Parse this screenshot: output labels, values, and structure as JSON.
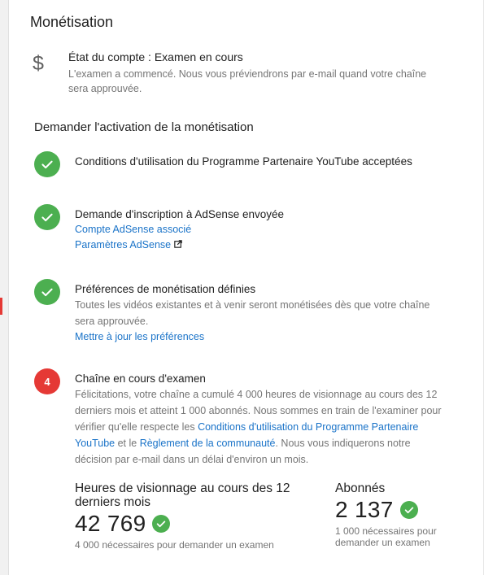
{
  "page": {
    "title": "Monétisation"
  },
  "account": {
    "icon": "dollar-icon",
    "status": "État du compte : Examen en cours",
    "description": "L'examen a commencé. Nous vous préviendrons par e-mail quand votre chaîne sera approuvée."
  },
  "section": {
    "title": "Demander l'activation de la monétisation"
  },
  "steps": [
    {
      "state": "done",
      "title": "Conditions d'utilisation du Programme Partenaire YouTube acceptées"
    },
    {
      "state": "done",
      "title": "Demande d'inscription à AdSense envoyée",
      "links": [
        "Compte AdSense associé",
        "Paramètres AdSense"
      ]
    },
    {
      "state": "done",
      "title": "Préférences de monétisation définies",
      "description": "Toutes les vidéos existantes et à venir seront monétisées dès que votre chaîne sera approuvée.",
      "links": [
        "Mettre à jour les préférences"
      ]
    },
    {
      "state": "active",
      "number": "4",
      "title": "Chaîne en cours d'examen",
      "description_part1": "Félicitations, votre chaîne a cumulé 4 000 heures de visionnage au cours des 12 derniers mois et atteint 1 000 abonnés. Nous sommes en train de l'examiner pour vérifier qu'elle respecte les ",
      "link1": "Conditions d'utilisation du Programme Partenaire YouTube",
      "description_part2": " et le ",
      "link2": "Règlement de la communauté",
      "description_part3": ". Nous vous indiquerons notre décision par e-mail dans un délai d'environ un mois."
    }
  ],
  "stats": {
    "watch_hours": {
      "label": "Heures de visionnage au cours des 12 derniers mois",
      "value": "42 769",
      "hint": "4 000 nécessaires pour demander un examen"
    },
    "subscribers": {
      "label": "Abonnés",
      "value": "2 137",
      "hint": "1 000 nécessaires pour demander un examen"
    }
  },
  "colors": {
    "success": "#4caf50",
    "active": "#e53935",
    "link": "#1a73c8",
    "muted": "#757575"
  }
}
